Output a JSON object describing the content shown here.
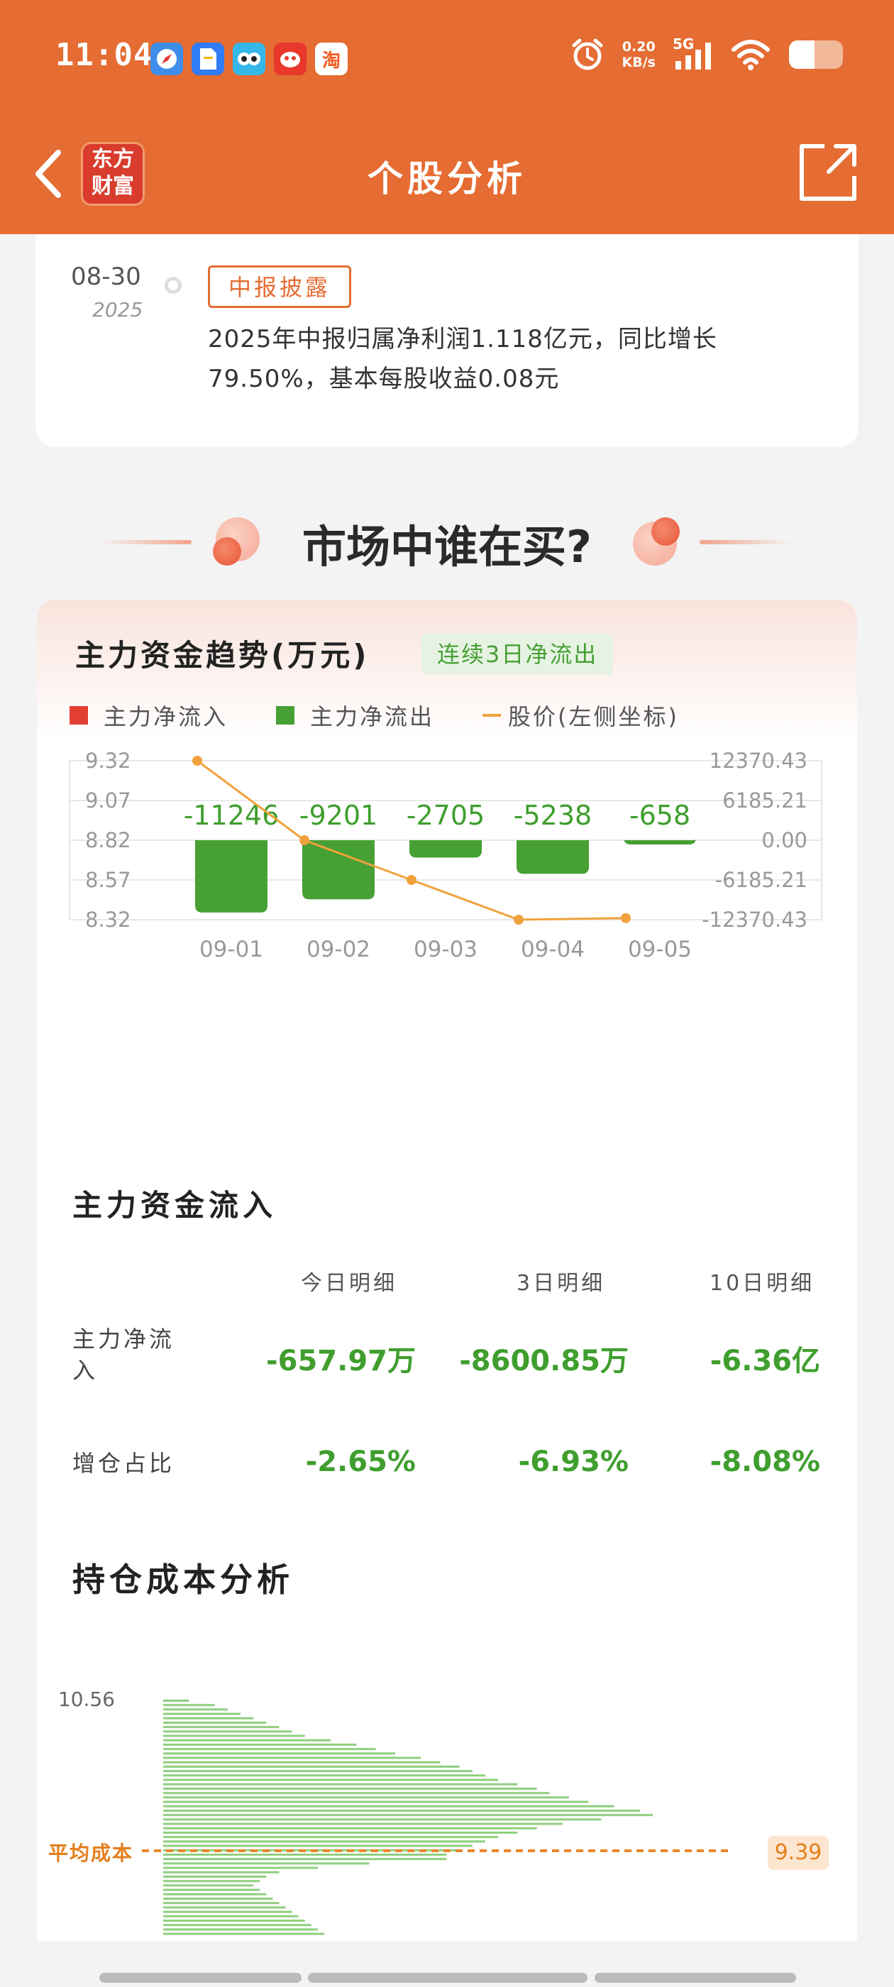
{
  "status_bar": {
    "time": "11:04",
    "net_speed_value": "0.20",
    "net_speed_unit": "KB/s",
    "network": "5G",
    "notif_icons": [
      "compass-app-icon",
      "docs-app-icon",
      "owl-app-icon",
      "red-app-icon",
      "taobao-app-icon"
    ],
    "taobao_glyph": "淘"
  },
  "nav": {
    "title": "个股分析",
    "logo_line1": "东方",
    "logo_line2": "财富"
  },
  "notice": {
    "date": "08-30",
    "year": "2025",
    "tag": "中报披露",
    "text": "2025年中报归属净利润1.118亿元，同比增长79.50%，基本每股收益0.08元"
  },
  "market": {
    "title": "市场中谁在买?"
  },
  "trend": {
    "title": "主力资金趋势(万元)",
    "badge": "连续3日净流出",
    "legend_inflow": "主力净流入",
    "legend_outflow": "主力净流出",
    "legend_price": "股价(左侧坐标)"
  },
  "chart_data": {
    "type": "bar",
    "categories": [
      "09-01",
      "09-02",
      "09-03",
      "09-04",
      "09-05"
    ],
    "series": [
      {
        "name": "主力净流出",
        "values": [
          -11246,
          -9201,
          -2705,
          -5238,
          -658
        ],
        "color": "#47a034"
      },
      {
        "name": "股价(左侧坐标)",
        "values": [
          9.32,
          8.82,
          8.57,
          8.32,
          8.33
        ],
        "color": "#f0a23c"
      }
    ],
    "value_labels": [
      "-11246",
      "-9201",
      "-2705",
      "-5238",
      "-658"
    ],
    "left_ticks": [
      "9.32",
      "9.07",
      "8.82",
      "8.57",
      "8.32"
    ],
    "right_ticks": [
      "12370.43",
      "6185.21",
      "0.00",
      "-6185.21",
      "-12370.43"
    ],
    "left_ylim": [
      8.32,
      9.32
    ],
    "right_ylim": [
      -12370.43,
      12370.43
    ],
    "grid": true,
    "inflow_color": "#e33e33"
  },
  "inflow": {
    "title": "主力资金流入",
    "columns": [
      "今日明细",
      "3日明细",
      "10日明细"
    ],
    "rows": [
      {
        "label": "主力净流入",
        "values": [
          "-657.97万",
          "-8600.85万",
          "-6.36亿"
        ]
      },
      {
        "label": "增仓占比",
        "values": [
          "-2.65%",
          "-6.93%",
          "-8.08%"
        ]
      }
    ]
  },
  "cost": {
    "title": "持仓成本分析",
    "top_price": "10.56",
    "avg_label": "平均成本",
    "avg_value": "9.39",
    "distribution": [
      4,
      8,
      10,
      12,
      14,
      16,
      18,
      20,
      22,
      26,
      30,
      33,
      36,
      40,
      43,
      46,
      48,
      50,
      52,
      55,
      58,
      60,
      63,
      66,
      70,
      74,
      76,
      68,
      62,
      58,
      55,
      52,
      50,
      48,
      46,
      44,
      44,
      32,
      24,
      18,
      16,
      15,
      14,
      15,
      16,
      17,
      18,
      19,
      20,
      21,
      22,
      23,
      24,
      25
    ]
  }
}
